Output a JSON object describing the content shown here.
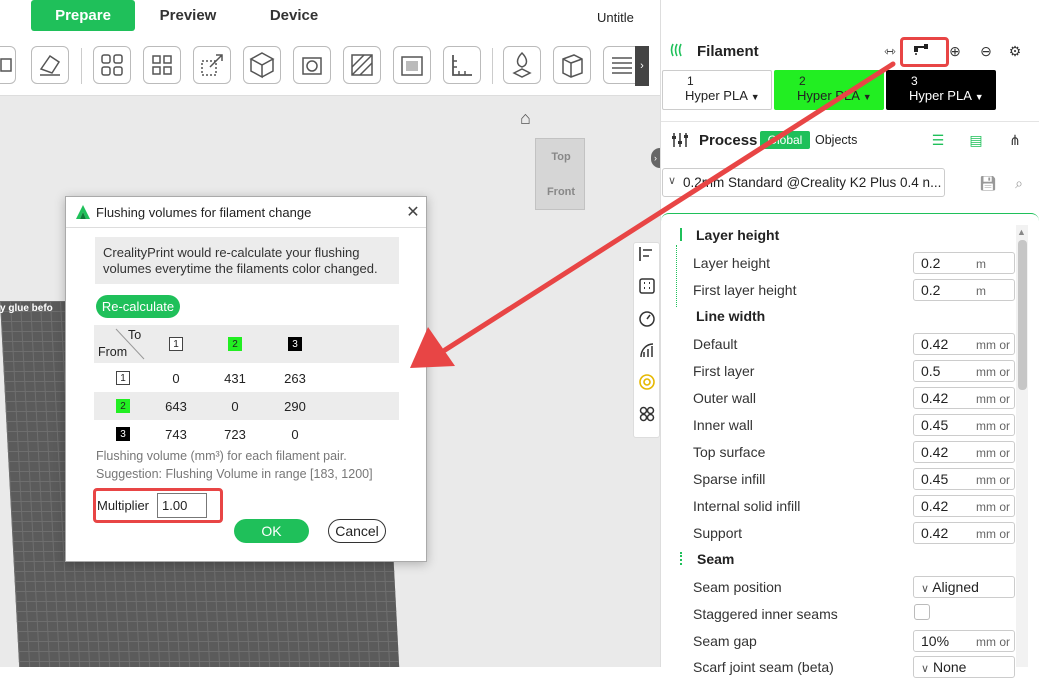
{
  "tabs": {
    "prepare": "Prepare",
    "preview": "Preview",
    "device": "Device"
  },
  "window_title": "Untitle",
  "plate_label": "y glue befo",
  "cube": {
    "top": "Top",
    "front": "Front"
  },
  "filament": {
    "title": "Filament",
    "slots": [
      {
        "num": "1",
        "type": "Hyper PLA",
        "color": "#ffffff"
      },
      {
        "num": "2",
        "type": "Hyper PLA",
        "color": "#22ee22"
      },
      {
        "num": "3",
        "type": "Hyper PLA",
        "color": "#000000"
      }
    ]
  },
  "process": {
    "title": "Process",
    "global": "Global",
    "objects": "Objects",
    "preset": "0.2mm Standard @Creality K2 Plus 0.4 n..."
  },
  "settings": {
    "layer_height_section": "Layer height",
    "layer_height": {
      "label": "Layer height",
      "value": "0.2",
      "unit": "m"
    },
    "first_layer_height": {
      "label": "First layer height",
      "value": "0.2",
      "unit": "m"
    },
    "line_width_section": "Line width",
    "default": {
      "label": "Default",
      "value": "0.42",
      "unit": "mm or"
    },
    "first_layer": {
      "label": "First layer",
      "value": "0.5",
      "unit": "mm or"
    },
    "outer_wall": {
      "label": "Outer wall",
      "value": "0.42",
      "unit": "mm or"
    },
    "inner_wall": {
      "label": "Inner wall",
      "value": "0.45",
      "unit": "mm or"
    },
    "top_surface": {
      "label": "Top surface",
      "value": "0.42",
      "unit": "mm or"
    },
    "sparse_infill": {
      "label": "Sparse infill",
      "value": "0.45",
      "unit": "mm or"
    },
    "internal_solid_infill": {
      "label": "Internal solid infill",
      "value": "0.42",
      "unit": "mm or"
    },
    "support": {
      "label": "Support",
      "value": "0.42",
      "unit": "mm or"
    },
    "seam_section": "Seam",
    "seam_position": {
      "label": "Seam position",
      "value": "Aligned"
    },
    "staggered_inner_seams": {
      "label": "Staggered inner seams"
    },
    "seam_gap": {
      "label": "Seam gap",
      "value": "10%",
      "unit": "mm or"
    },
    "scarf_joint": {
      "label": "Scarf joint seam (beta)",
      "value": "None"
    }
  },
  "dialog": {
    "title": "Flushing volumes for filament change",
    "info_line1": "CrealityPrint would re-calculate your flushing",
    "info_line2": "volumes everytime the filaments color changed.",
    "recalculate": "Re-calculate",
    "to_label": "To",
    "from_label": "From",
    "chips": [
      "1",
      "2",
      "3"
    ],
    "matrix": [
      [
        "0",
        "431",
        "263"
      ],
      [
        "643",
        "0",
        "290"
      ],
      [
        "743",
        "723",
        "0"
      ]
    ],
    "note_line1": "Flushing volume (mm³) for each filament pair.",
    "note_line2": "Suggestion: Flushing Volume in range [183, 1200]",
    "multiplier_label": "Multiplier",
    "multiplier_value": "1.00",
    "ok": "OK",
    "cancel": "Cancel",
    "close": "✕"
  },
  "colors": {
    "accent": "#1fc05a",
    "highlight": "#e84545"
  }
}
